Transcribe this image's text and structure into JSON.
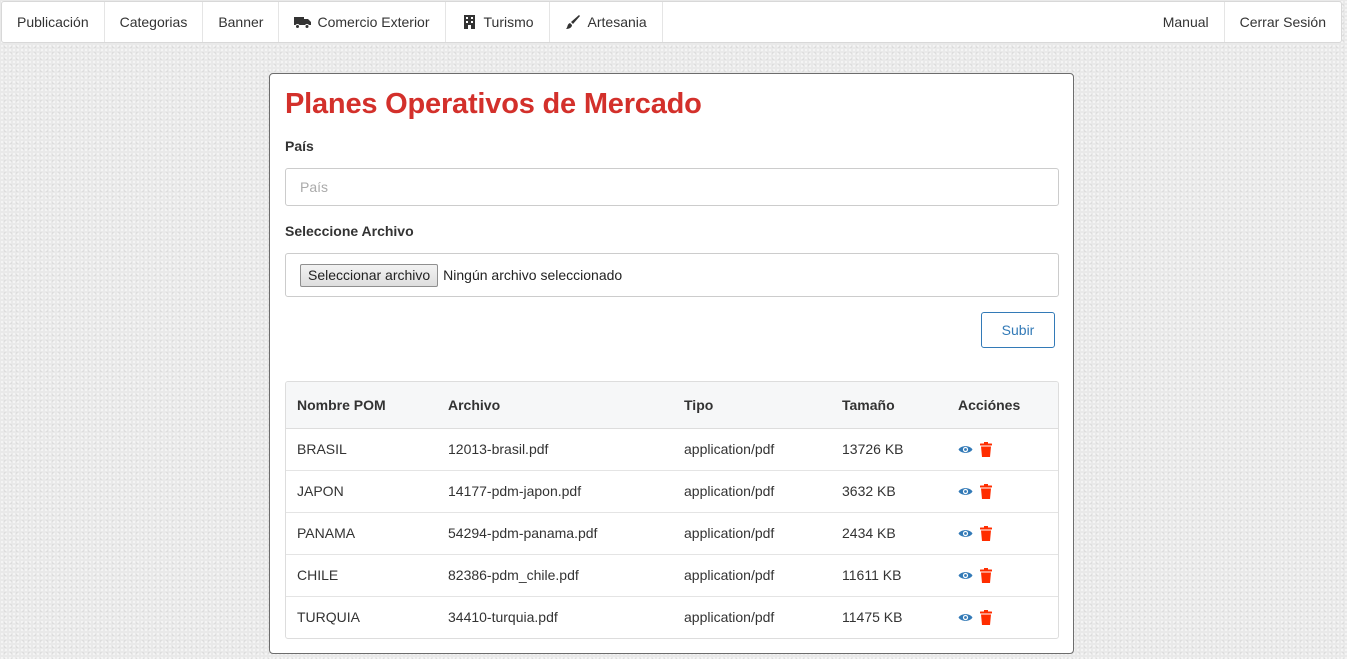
{
  "navbar": {
    "left": [
      {
        "label": "Publicación",
        "icon": null
      },
      {
        "label": "Categorias",
        "icon": null
      },
      {
        "label": "Banner",
        "icon": null
      },
      {
        "label": "Comercio Exterior",
        "icon": "truck-icon"
      },
      {
        "label": "Turismo",
        "icon": "building-icon"
      },
      {
        "label": "Artesania",
        "icon": "brush-icon"
      }
    ],
    "right": [
      {
        "label": "Manual"
      },
      {
        "label": "Cerrar Sesión"
      }
    ]
  },
  "page": {
    "title": "Planes Operativos de Mercado",
    "pais_label": "País",
    "pais_placeholder": "País",
    "pais_value": "",
    "archivo_label": "Seleccione Archivo",
    "file_button_label": "Seleccionar archivo",
    "file_status": "Ningún archivo seleccionado",
    "submit_label": "Subir"
  },
  "table": {
    "headers": {
      "nombre": "Nombre POM",
      "archivo": "Archivo",
      "tipo": "Tipo",
      "tamano": "Tamaño",
      "acciones": "Acciónes"
    },
    "rows": [
      {
        "nombre": "BRASIL",
        "archivo": "12013-brasil.pdf",
        "tipo": "application/pdf",
        "tamano": "13726 KB"
      },
      {
        "nombre": "JAPON",
        "archivo": "14177-pdm-japon.pdf",
        "tipo": "application/pdf",
        "tamano": "3632 KB"
      },
      {
        "nombre": "PANAMA",
        "archivo": "54294-pdm-panama.pdf",
        "tipo": "application/pdf",
        "tamano": "2434 KB"
      },
      {
        "nombre": "CHILE",
        "archivo": "82386-pdm_chile.pdf",
        "tipo": "application/pdf",
        "tamano": "11611 KB"
      },
      {
        "nombre": "TURQUIA",
        "archivo": "34410-turquia.pdf",
        "tipo": "application/pdf",
        "tamano": "11475 KB"
      }
    ]
  },
  "colors": {
    "title": "#d3302b",
    "primary": "#337ab7",
    "danger": "#ff2d00"
  },
  "icons": {
    "view": "eye-icon",
    "delete": "trash-icon"
  }
}
